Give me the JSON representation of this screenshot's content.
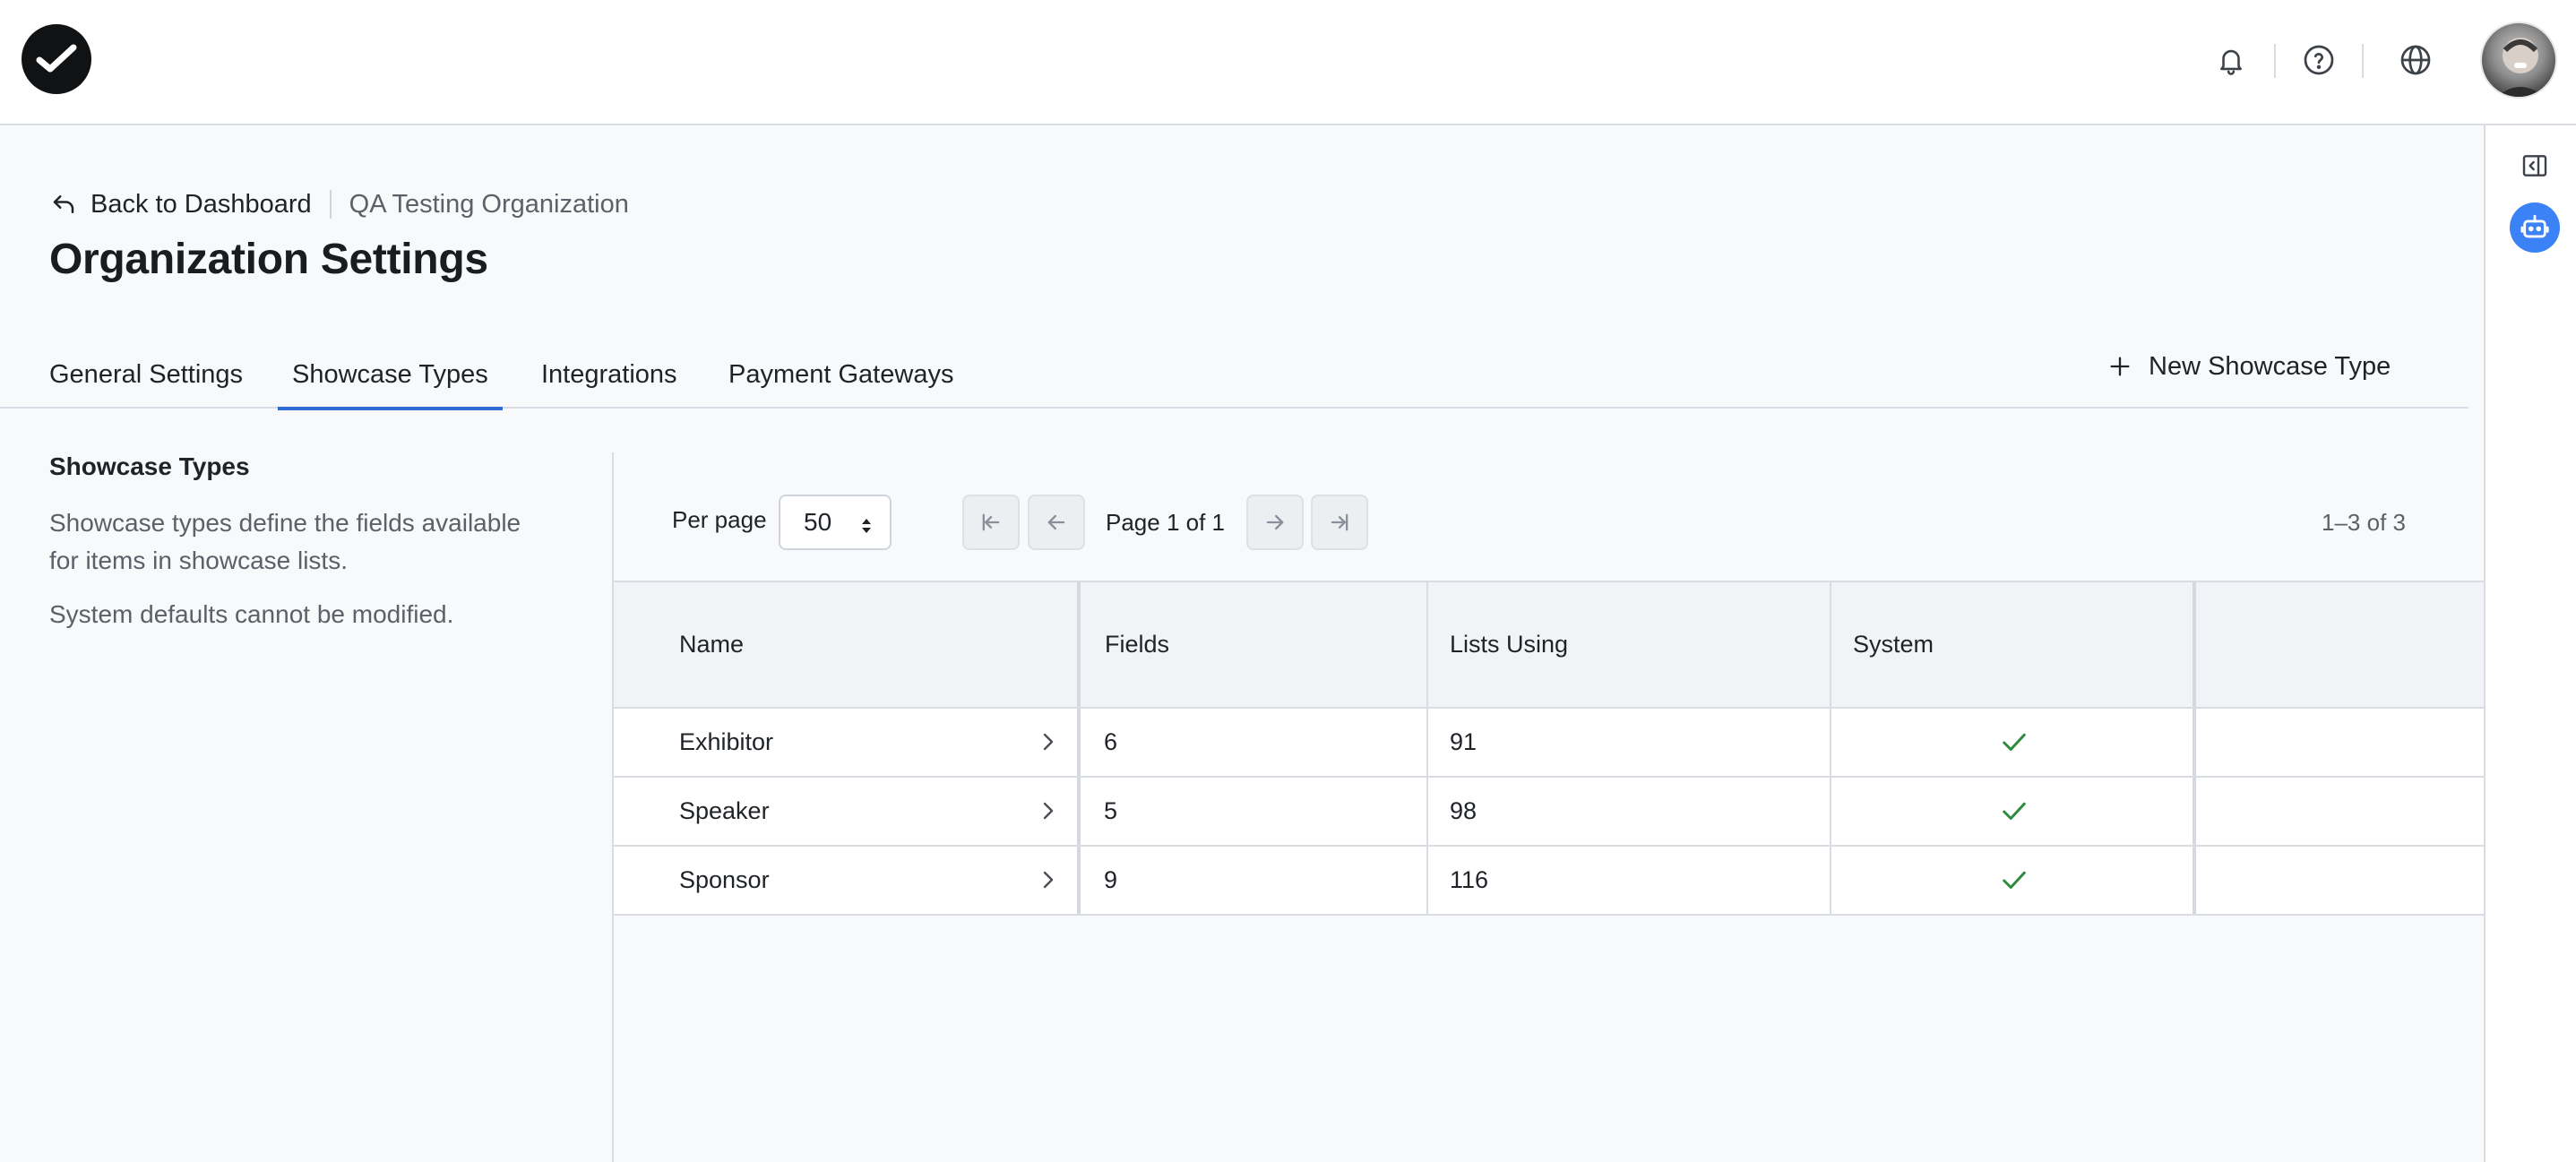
{
  "topbar": {
    "icons": [
      "checkmark-logo-icon",
      "bell-icon",
      "help-circle-icon",
      "globe-icon",
      "avatar"
    ]
  },
  "header": {
    "back_label": "Back to Dashboard",
    "org_name": "QA Testing Organization",
    "title": "Organization Settings"
  },
  "tabs": [
    {
      "label": "General Settings",
      "active": false
    },
    {
      "label": "Showcase Types",
      "active": true
    },
    {
      "label": "Integrations",
      "active": false
    },
    {
      "label": "Payment Gateways",
      "active": false
    }
  ],
  "new_button_label": "New Showcase Type",
  "left_panel": {
    "title": "Showcase Types",
    "description": "Showcase types define the fields available for items in showcase lists.",
    "note": "System defaults cannot be modified."
  },
  "pagination": {
    "per_page_label": "Per page",
    "per_page_value": "50",
    "page_label": "Page 1 of 1",
    "range_label": "1–3 of 3"
  },
  "table": {
    "columns": [
      "Name",
      "Fields",
      "Lists Using",
      "System",
      ""
    ],
    "rows": [
      {
        "name": "Exhibitor",
        "fields": "6",
        "lists_using": "91",
        "system": true
      },
      {
        "name": "Speaker",
        "fields": "5",
        "lists_using": "98",
        "system": true
      },
      {
        "name": "Sponsor",
        "fields": "9",
        "lists_using": "116",
        "system": true
      }
    ]
  },
  "colors": {
    "accent": "#2f6bd6",
    "bot_button": "#3b82f6",
    "check": "#2e8b3e"
  }
}
